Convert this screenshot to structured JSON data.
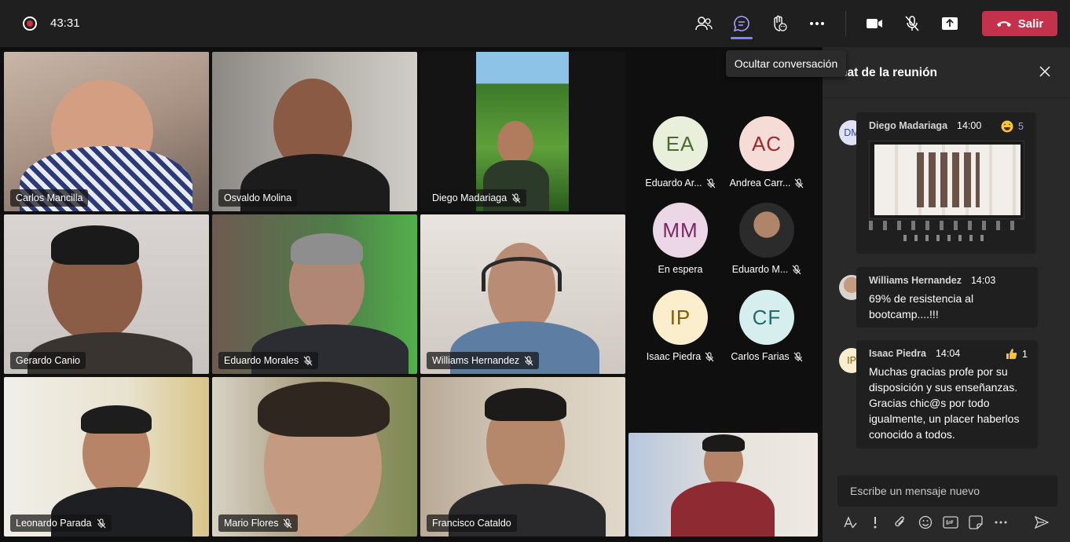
{
  "topbar": {
    "timer": "43:31",
    "leave_label": "Salir",
    "tooltip": "Ocultar conversación",
    "icons": [
      "record-icon",
      "people-icon",
      "chat-icon",
      "reactions-icon",
      "more-icon",
      "camera-icon",
      "mic-off-icon",
      "share-icon",
      "phone-icon"
    ]
  },
  "colors": {
    "accent": "#7f85f5",
    "leave": "#c4314b",
    "panel": "#292929",
    "bubble": "#1f1f1f"
  },
  "video_tiles": [
    {
      "name": "Carlos Mancilla",
      "muted": false,
      "active": true
    },
    {
      "name": "Osvaldo Molina",
      "muted": false,
      "active": false
    },
    {
      "name": "Diego Madariaga",
      "muted": true,
      "active": false
    },
    {
      "name": "Gerardo Canio",
      "muted": false,
      "active": true
    },
    {
      "name": "Eduardo Morales",
      "muted": true,
      "active": false
    },
    {
      "name": "Williams Hernandez",
      "muted": true,
      "active": false
    },
    {
      "name": "Leonardo Parada",
      "muted": true,
      "active": false
    },
    {
      "name": "Mario Flores",
      "muted": true,
      "active": false
    },
    {
      "name": "Francisco Cataldo",
      "muted": false,
      "active": false
    }
  ],
  "roster": [
    {
      "initials": "EA",
      "name": "Eduardo Ar...",
      "muted": true,
      "bg": "#e8f0dc",
      "fg": "#4d6b2b"
    },
    {
      "initials": "AC",
      "name": "Andrea Carr...",
      "muted": true,
      "bg": "#f6dcd7",
      "fg": "#a4262c"
    },
    {
      "initials": "MM",
      "name": "En espera",
      "muted": false,
      "bg": "#ecd7e6",
      "fg": "#7a2868"
    },
    {
      "initials": "",
      "name": "Eduardo M...",
      "muted": true,
      "bg": "#3b3b3b",
      "fg": "#ffffff"
    },
    {
      "initials": "IP",
      "name": "Isaac Piedra",
      "muted": true,
      "bg": "#fbeecd",
      "fg": "#8a5a00"
    },
    {
      "initials": "CF",
      "name": "Carlos Farias",
      "muted": true,
      "bg": "#d7eeee",
      "fg": "#1f6b6e"
    }
  ],
  "chat": {
    "title": "hat de la reunión",
    "compose_placeholder": "Escribe un mensaje nuevo",
    "messages": [
      {
        "initials": "DM",
        "author": "Diego Madariaga",
        "time": "14:00",
        "text": "",
        "reaction_icon": "laugh-emoji-icon",
        "reaction_count": "5"
      },
      {
        "initials": "",
        "author": "Williams Hernandez",
        "time": "14:03",
        "text_lines": [
          "69% de resistencia al",
          "bootcamp....!!!"
        ]
      },
      {
        "initials": "IP",
        "author": "Isaac Piedra",
        "time": "14:04",
        "reaction_icon": "thumbs-up-emoji-icon",
        "reaction_count": "1",
        "text_lines": [
          "Muchas gracias profe por su",
          "disposición y sus enseñanzas.",
          "Gracias chic@s por todo",
          "igualmente, un placer haberlos",
          "conocido a todos."
        ]
      }
    ],
    "tools": [
      "format-icon",
      "important-icon",
      "attach-icon",
      "emoji-icon",
      "gif-icon",
      "sticker-icon",
      "more-icon",
      "send-icon"
    ]
  }
}
